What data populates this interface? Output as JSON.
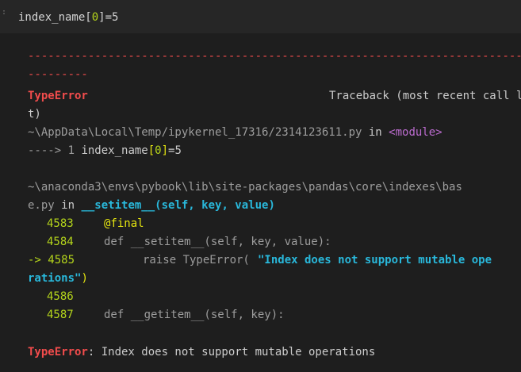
{
  "input": {
    "gutter": ":",
    "code_prefix": "index_name[",
    "code_index": "0",
    "code_suffix": "]=5"
  },
  "output": {
    "separator_1": "---------------------------------------------------------------------------",
    "separator_2": "---------",
    "error_name": "TypeError",
    "traceback_header_1": "Traceback (most recent call las",
    "traceback_header_2": "t)",
    "frame1_path": "~\\AppData\\Local\\Temp/ipykernel_17316/2314123611.py",
    "frame1_in": " in ",
    "frame1_module": "<module>",
    "frame1_arrow": "----> 1 ",
    "frame1_code_a": "index_name",
    "frame1_code_b": "[",
    "frame1_code_c": "0",
    "frame1_code_d": "]",
    "frame1_code_e": "=5",
    "frame2_path_1": "~\\anaconda3\\envs\\pybook\\lib\\site-packages\\pandas\\core\\indexes\\bas",
    "frame2_path_2": "e.py",
    "frame2_in": " in ",
    "frame2_func": "__setitem__(self, key, value)",
    "lines": [
      {
        "no": "4583",
        "code": "@final"
      },
      {
        "no": "4584",
        "code": "def __setitem__(self, key, value):"
      },
      {
        "arrow": "-> ",
        "no": "4585",
        "code_a": "raise TypeError(",
        "code_str_1": "\"Index does not support mutable ope",
        "code_str_2": "rations\"",
        "code_end": ")"
      },
      {
        "no": "4586",
        "code": ""
      },
      {
        "no": "4587",
        "code": "def __getitem__(self, key):"
      }
    ],
    "final_error_name": "TypeError",
    "final_error_msg": ": Index does not support mutable operations"
  }
}
